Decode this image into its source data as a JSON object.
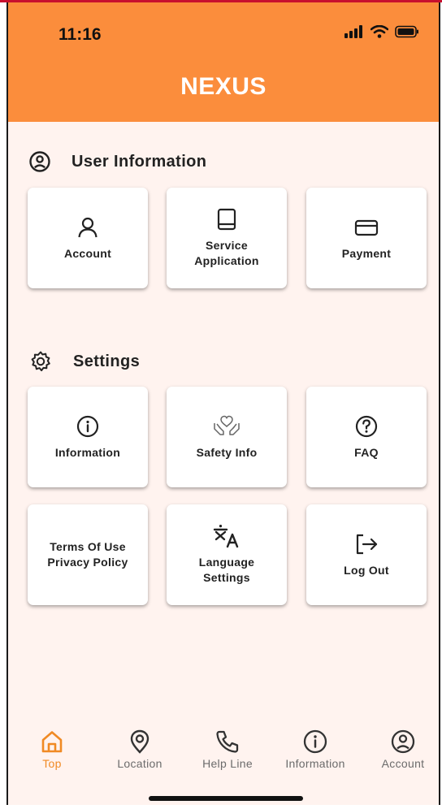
{
  "status": {
    "time": "11:16"
  },
  "app": {
    "title": "NEXUS"
  },
  "sections": {
    "user_info": {
      "title": "User Information",
      "icon": "user-circle-icon",
      "cards": [
        {
          "label": "Account",
          "icon": "person-icon"
        },
        {
          "label": "Service\nApplication",
          "icon": "book-icon"
        },
        {
          "label": "Payment",
          "icon": "card-icon"
        }
      ]
    },
    "settings": {
      "title": "Settings",
      "icon": "gear-icon",
      "cards": [
        {
          "label": "Information",
          "icon": "info-icon"
        },
        {
          "label": "Safety Info",
          "icon": "heart-hands-icon"
        },
        {
          "label": "FAQ",
          "icon": "question-icon"
        },
        {
          "label": "Terms Of Use\nPrivacy Policy",
          "icon": ""
        },
        {
          "label": "Language\nSettings",
          "icon": "translate-icon"
        },
        {
          "label": "Log Out",
          "icon": "logout-icon"
        }
      ]
    }
  },
  "tabs": [
    {
      "label": "Top",
      "icon": "home-icon",
      "active": true
    },
    {
      "label": "Location",
      "icon": "location-pin-icon",
      "active": false
    },
    {
      "label": "Help Line",
      "icon": "phone-icon",
      "active": false
    },
    {
      "label": "Information",
      "icon": "info-icon",
      "active": false
    },
    {
      "label": "Account",
      "icon": "user-circle-icon",
      "active": false
    }
  ],
  "colors": {
    "header": "#fb8d3c",
    "background": "#fff3ef",
    "active_tab": "#f08a24",
    "inactive_tab": "#6b6b6b"
  }
}
